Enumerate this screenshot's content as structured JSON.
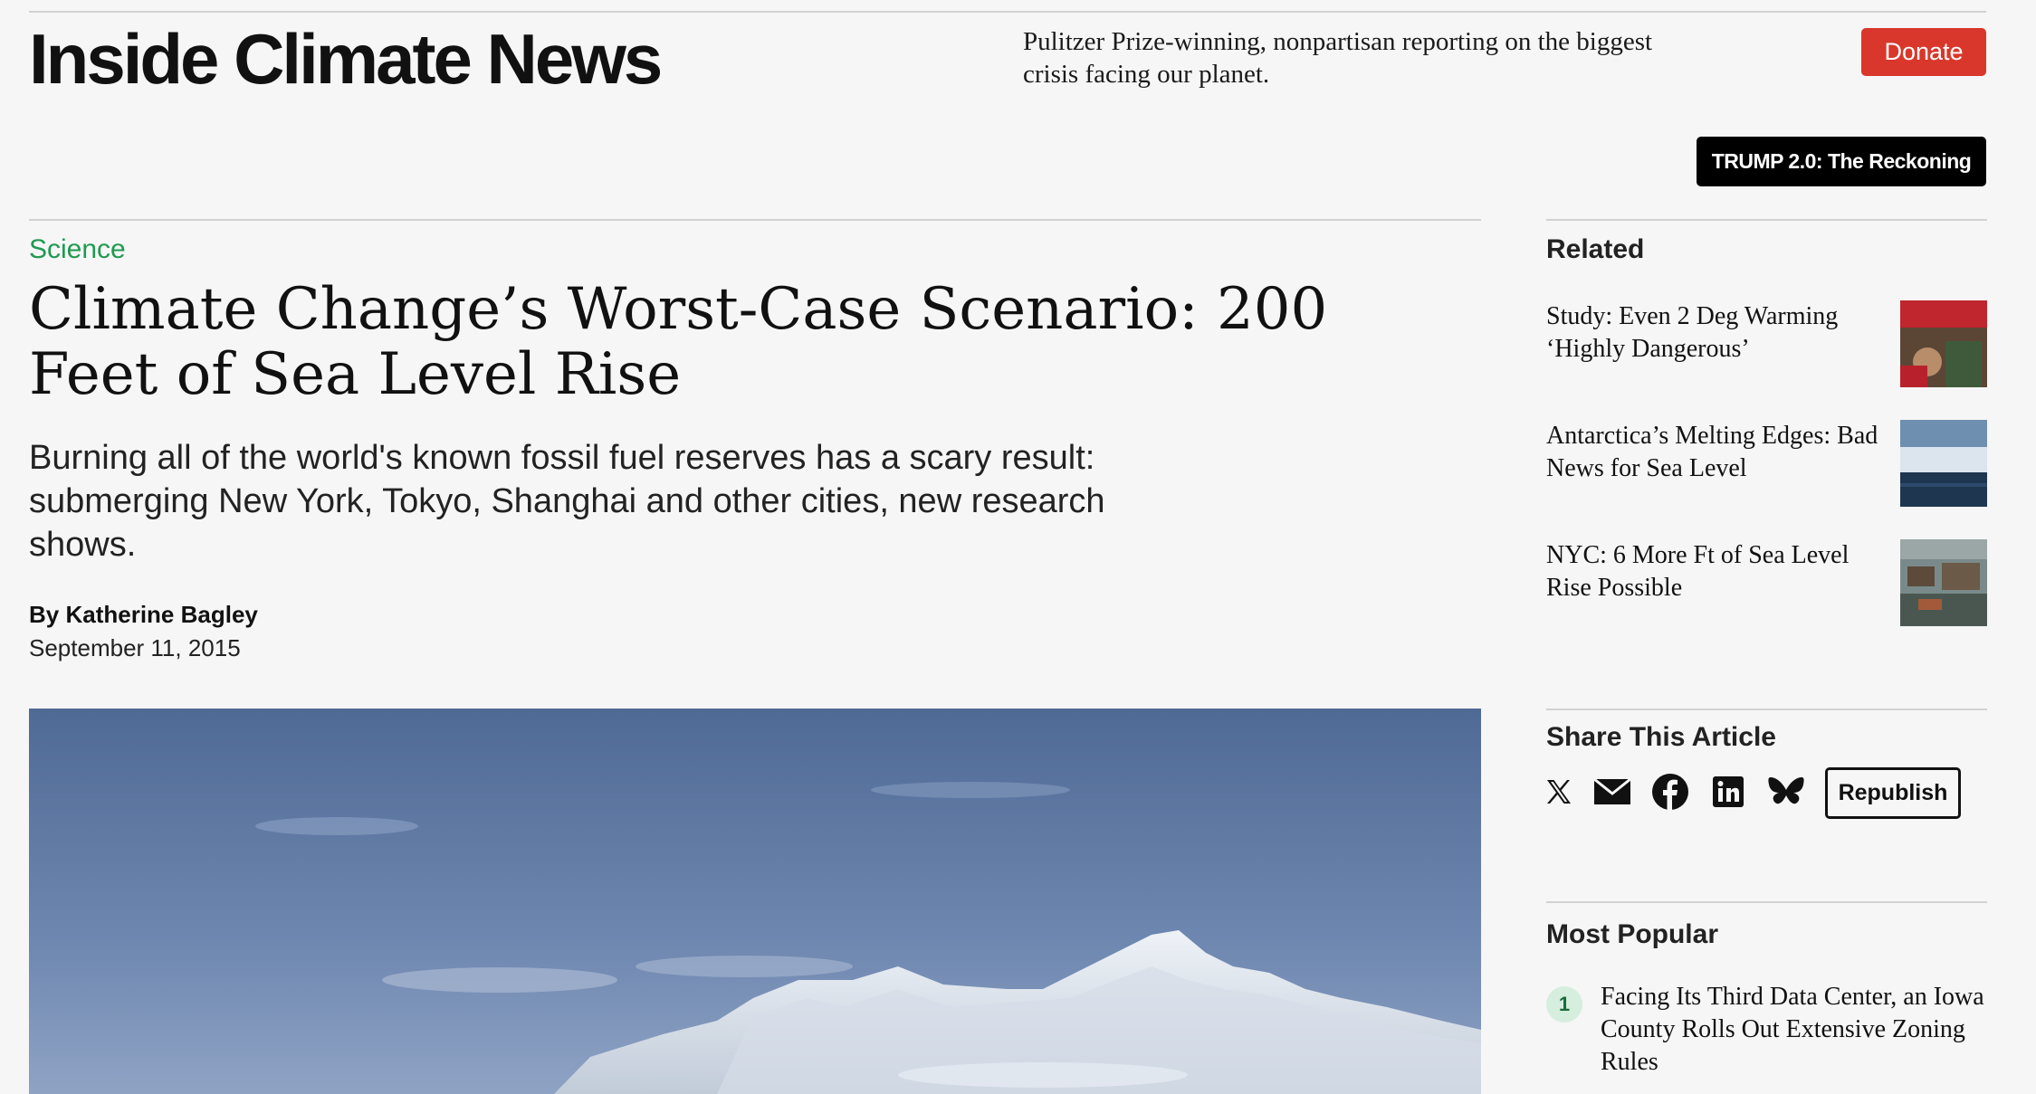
{
  "header": {
    "logo": "Inside Climate News",
    "tagline": "Pulitzer Prize-winning, nonpartisan reporting on the biggest crisis facing our planet.",
    "donate_label": "Donate",
    "series_label": "TRUMP 2.0: The Reckoning"
  },
  "article": {
    "category": "Science",
    "headline": "Climate Change’s Worst-Case Scenario: 200 Feet of Sea Level Rise",
    "dek": "Burning all of the world's known fossil fuel reserves has a scary result: submerging New York, Tokyo, Shanghai and other cities, new research shows.",
    "byline": "By Katherine Bagley",
    "date": "September 11, 2015"
  },
  "related": {
    "title": "Related",
    "items": [
      {
        "title": "Study: Even 2 Deg Warming ‘Highly Dangerous’"
      },
      {
        "title": "Antarctica’s Melting Edges: Bad News for Sea Level"
      },
      {
        "title": "NYC: 6 More Ft of Sea Level Rise Possible"
      }
    ]
  },
  "share": {
    "title": "Share This Article",
    "icons": [
      "x-icon",
      "email-icon",
      "facebook-icon",
      "linkedin-icon",
      "bluesky-icon"
    ],
    "republish_label": "Republish"
  },
  "popular": {
    "title": "Most Popular",
    "items": [
      {
        "rank": "1",
        "title": "Facing Its Third Data Center, an Iowa County Rolls Out Extensive Zoning Rules"
      }
    ]
  },
  "colors": {
    "accent_green": "#1f9a50",
    "donate_red": "#d9372b",
    "background": "#f6f6f6"
  }
}
